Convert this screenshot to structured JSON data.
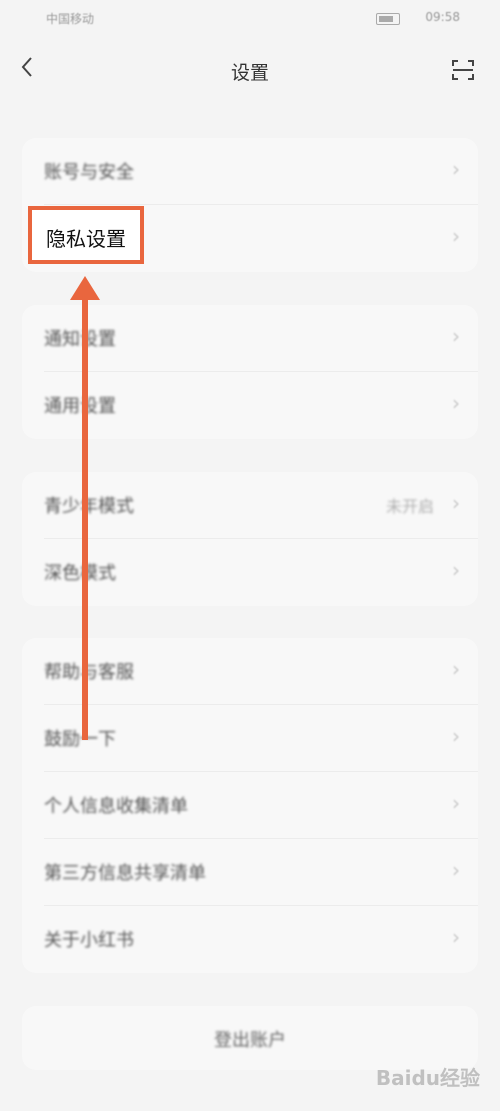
{
  "status_bar": {
    "carrier": "中国移动",
    "time": "09:58"
  },
  "header": {
    "title": "设置",
    "back_icon": "chevron-left-icon",
    "scan_icon": "scan-icon"
  },
  "groups": [
    {
      "items": [
        {
          "label": "账号与安全"
        },
        {
          "label": "隐私设置"
        }
      ]
    },
    {
      "items": [
        {
          "label": "通知设置"
        },
        {
          "label": "通用设置"
        }
      ]
    },
    {
      "items": [
        {
          "label": "青少年模式",
          "value": "未开启"
        },
        {
          "label": "深色模式"
        }
      ]
    },
    {
      "items": [
        {
          "label": "帮助与客服"
        },
        {
          "label": "鼓励一下"
        },
        {
          "label": "个人信息收集清单"
        },
        {
          "label": "第三方信息共享清单"
        },
        {
          "label": "关于小红书"
        }
      ]
    }
  ],
  "highlight": {
    "label": "隐私设置",
    "color": "#e9663e"
  },
  "logout": {
    "label": "登出账户"
  },
  "watermark": {
    "text": "Baidu经验"
  }
}
